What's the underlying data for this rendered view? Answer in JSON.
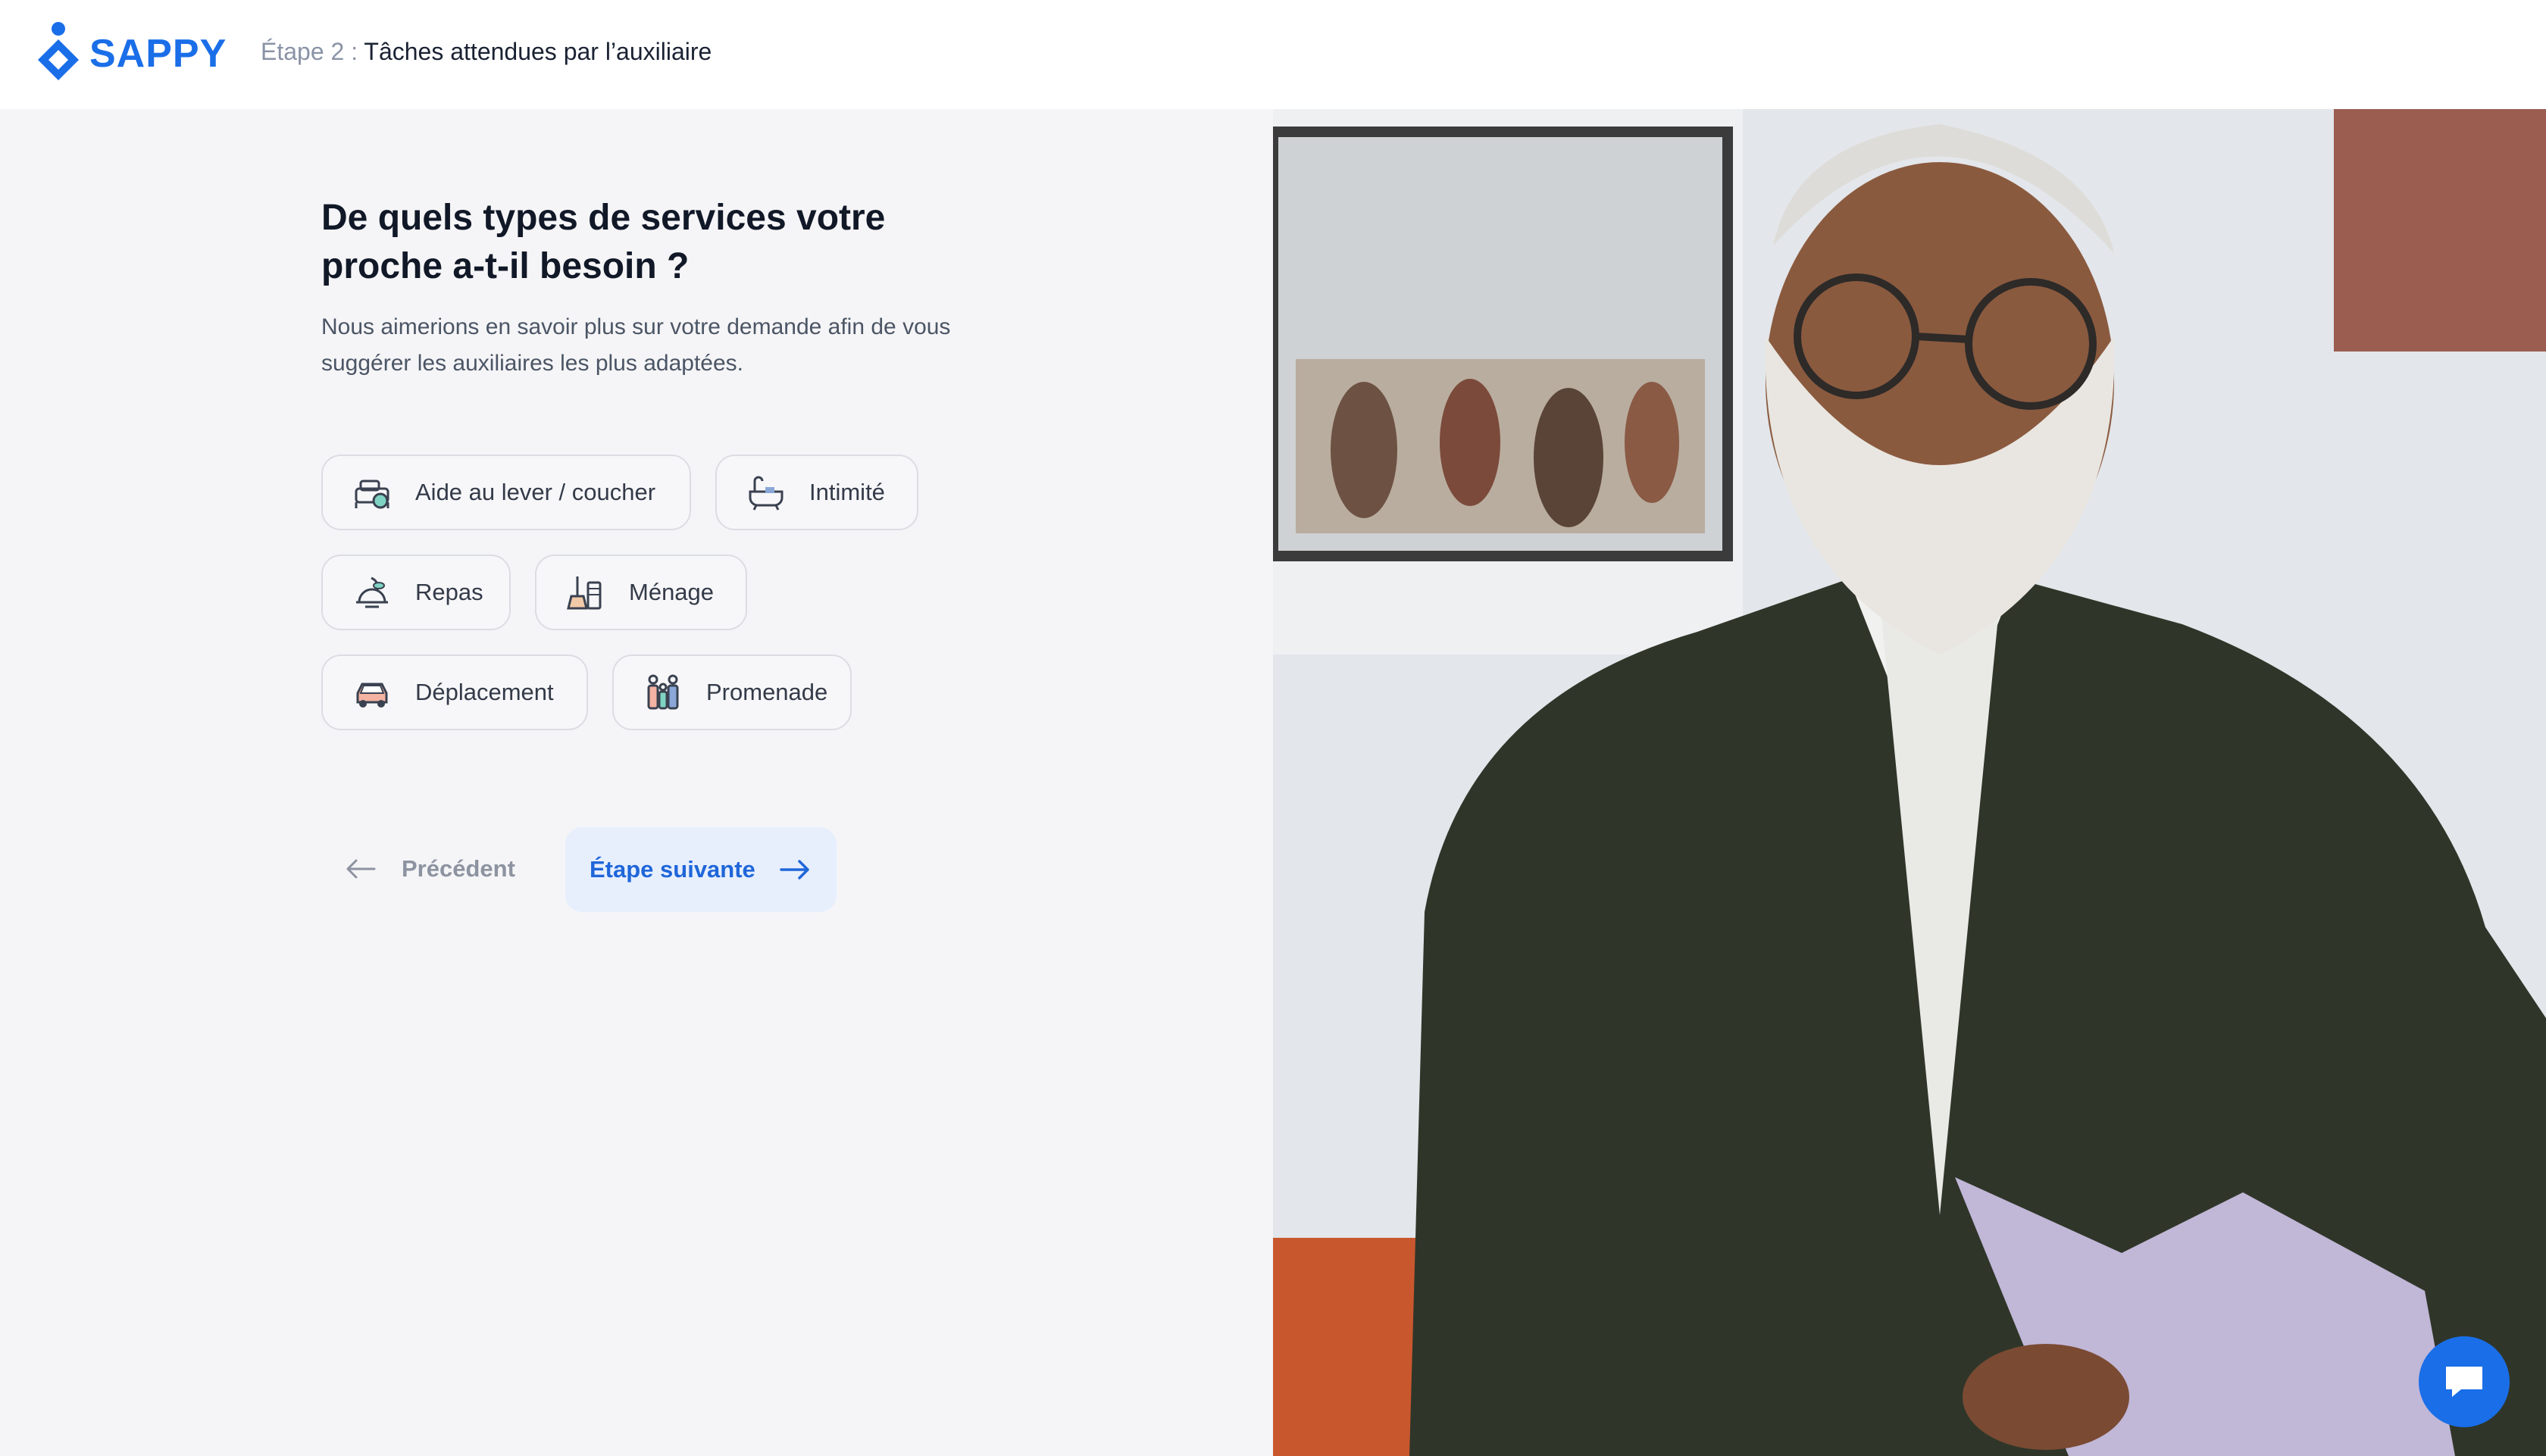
{
  "brand": {
    "name": "SAPPY",
    "color": "#1a6ee8"
  },
  "header": {
    "step_label": "Étape 2 :",
    "step_title": "Tâches attendues par l’auxiliaire"
  },
  "main": {
    "title": "De quels types de services votre proche a-t-il besoin ?",
    "subtitle": "Nous aimerions en savoir plus sur votre demande afin de vous suggérer les auxiliaires les plus adaptées.",
    "services": [
      {
        "label": "Aide au lever / coucher",
        "icon": "bed-care-icon"
      },
      {
        "label": "Intimité",
        "icon": "bathtub-icon"
      },
      {
        "label": "Repas",
        "icon": "meal-icon"
      },
      {
        "label": "Ménage",
        "icon": "cleaning-icon"
      },
      {
        "label": "Déplacement",
        "icon": "car-icon"
      },
      {
        "label": "Promenade",
        "icon": "family-walk-icon"
      }
    ]
  },
  "nav": {
    "previous_label": "Précédent",
    "next_label": "Étape suivante"
  },
  "chat": {
    "icon": "chat-icon"
  }
}
